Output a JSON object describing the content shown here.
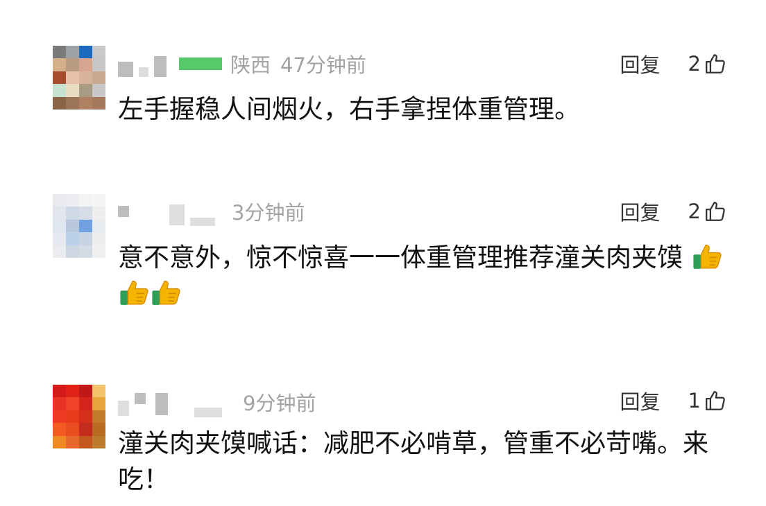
{
  "comments": [
    {
      "location": "陕西",
      "time": "47分钟前",
      "reply_label": "回复",
      "likes": "2",
      "text": "左手握稳人间烟火，右手拿捏体重管理。",
      "avatar_colors": [
        "#7a7a7a",
        "#9ea3a8",
        "#1b6bc1",
        "#c9c9c9",
        "#d6b08b",
        "#b99c82",
        "#d8a690",
        "#c7c7c7",
        "#a64c2c",
        "#e6c0a9",
        "#d8b49c",
        "#c9a98e",
        "#c6e3d0",
        "#e8dcc2",
        "#a99a83",
        "#c8c8c8",
        "#8b6446",
        "#9c7459",
        "#b08063",
        "#a5795c"
      ]
    },
    {
      "location": "",
      "time": "3分钟前",
      "reply_label": "回复",
      "likes": "2",
      "text": "意不意外，惊不惊喜一一体重管理推荐潼关肉夹馍",
      "avatar_colors": [
        "#e8eaee",
        "#eceef2",
        "#f2f3f5",
        "#f5f5f5",
        "#e2e6ec",
        "#cfd8e6",
        "#d7dde7",
        "#eeeeee",
        "#dfe6f0",
        "#b8c7de",
        "#6fa0e0",
        "#e8ebef",
        "#e6eaf0",
        "#bcd0ea",
        "#c7d3e3",
        "#eeeeee",
        "#eaecef",
        "#cdd6e1",
        "#d3dbe5",
        "#f0f0f0"
      ]
    },
    {
      "location": "",
      "time": "9分钟前",
      "reply_label": "回复",
      "likes": "1",
      "text": "潼关肉夹馍喊话：减肥不必啃草，管重不必苛嘴。来吃！",
      "avatar_colors": [
        "#d41919",
        "#e2231a",
        "#c01717",
        "#f2c36b",
        "#e83227",
        "#f0432c",
        "#d3241c",
        "#e8a53b",
        "#ef3a22",
        "#e63a1b",
        "#d62f1a",
        "#c37a28",
        "#f45a22",
        "#ea4d1f",
        "#c32b1c",
        "#b96a23",
        "#f08a24",
        "#e6682a",
        "#c4571d",
        "#bd7a2c"
      ]
    }
  ],
  "emoji": {
    "name": "thumbs-up-emoji",
    "count": 3
  }
}
